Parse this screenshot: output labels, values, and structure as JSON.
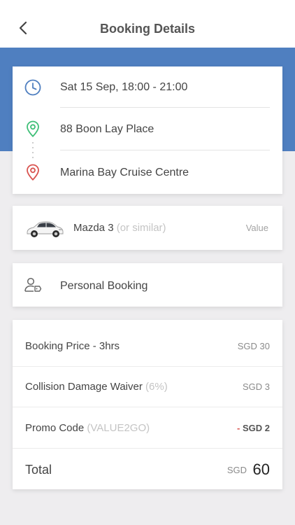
{
  "header": {
    "title": "Booking Details",
    "back_icon": "chevron-left-icon"
  },
  "colors": {
    "band": "#4f7fc0",
    "clock": "#4f7fc0",
    "pickup": "#3fbf77",
    "dropoff": "#d9534f",
    "discount": "#d9534f"
  },
  "route": {
    "datetime": "Sat 15 Sep, 18:00 - 21:00",
    "pickup": "88 Boon Lay Place",
    "dropoff": "Marina Bay Cruise Centre"
  },
  "car": {
    "name": "Mazda 3",
    "similar": "(or similar)",
    "class": "Value"
  },
  "booking_type": "Personal Booking",
  "price": {
    "lines": [
      {
        "label": "Booking Price - 3hrs",
        "sub": "",
        "currency": "SGD",
        "amount": "30"
      },
      {
        "label": "Collision Damage Waiver",
        "sub": "(6%)",
        "currency": "SGD",
        "amount": "3"
      },
      {
        "label": "Promo Code",
        "sub": "(VALUE2GO)",
        "prefix": "- ",
        "currency": "SGD",
        "amount": "2"
      }
    ],
    "total": {
      "label": "Total",
      "currency": "SGD",
      "amount": "60"
    }
  }
}
